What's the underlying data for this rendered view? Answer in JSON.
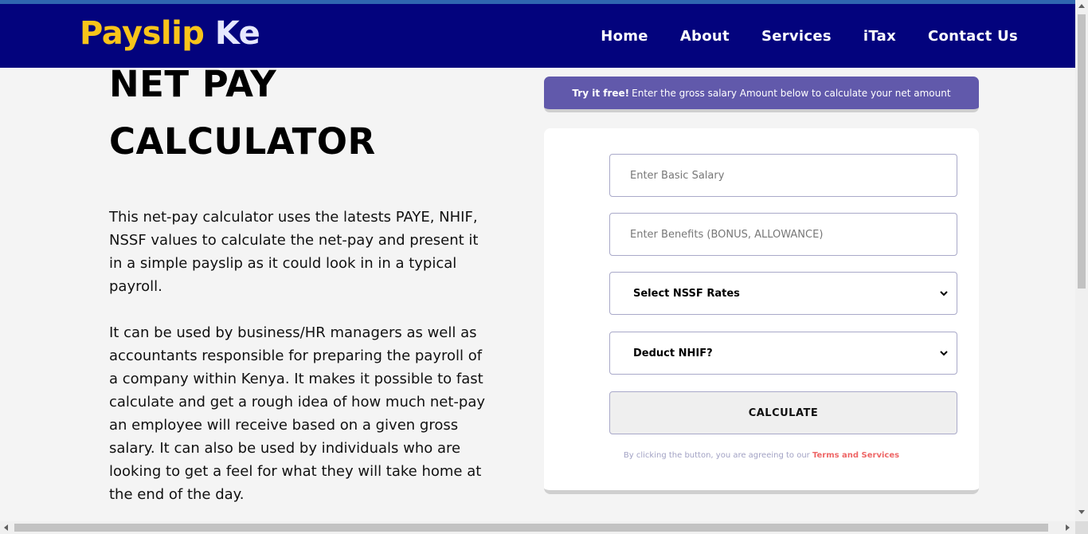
{
  "brand": {
    "part1": "Payslip",
    "part2": "Ke"
  },
  "nav": [
    "Home",
    "About",
    "Services",
    "iTax",
    "Contact Us"
  ],
  "hero": {
    "title_line1": "NET PAY",
    "title_line2": "CALCULATOR",
    "para1": "This net-pay calculator uses the latests PAYE, NHIF, NSSF values to calculate the net-pay and present it in a simple payslip as it could look in in a typical payroll.",
    "para2": "It can be used by business/HR managers as well as accountants responsible for preparing the payroll of a company within Kenya. It makes it possible to fast calculate and get a rough idea of how much net-pay an employee will receive based on a given gross salary. It can also be used by individuals who are looking to get a feel for what they will take home at the end of the day."
  },
  "banner": {
    "bold": "Try it free!",
    "text": "Enter the gross salary Amount below to calculate your net amount"
  },
  "form": {
    "basic_salary_placeholder": "Enter Basic  Salary",
    "benefits_placeholder": "Enter Benefits (BONUS, ALLOWANCE)",
    "nssf_selected": "Select NSSF Rates",
    "nhif_selected": "Deduct NHIF?",
    "calculate_label": "CALCULATE",
    "terms_prefix": "By clicking the button, you are agreeing to our",
    "terms_link": "Terms and Services"
  },
  "colors": {
    "navbar": "#03037d",
    "brand_yellow": "#f8c41a",
    "banner": "#6159ab",
    "terms_link": "#ee6666"
  }
}
